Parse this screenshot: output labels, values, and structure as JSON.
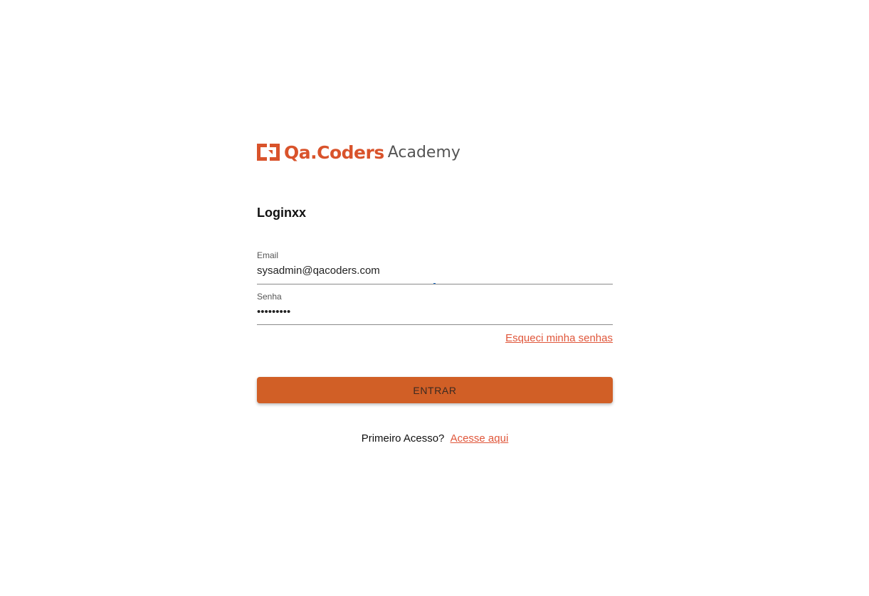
{
  "brand": {
    "logo_icon": "qa-coders-logo-mark",
    "name": "Qa.Coders",
    "suffix": "Academy",
    "accent_color": "#d9532b"
  },
  "login": {
    "title": "Loginxx",
    "email": {
      "label": "Email",
      "value": "sysadmin@qacoders.com"
    },
    "password": {
      "label": "Senha",
      "value": "•••••••••"
    },
    "forgot_link": "Esqueci minha senhas",
    "submit_label": "ENTRAR",
    "submit_color": "#d15f26",
    "first_access_text": "Primeiro Acesso?",
    "first_access_link": "Acesse aqui"
  }
}
